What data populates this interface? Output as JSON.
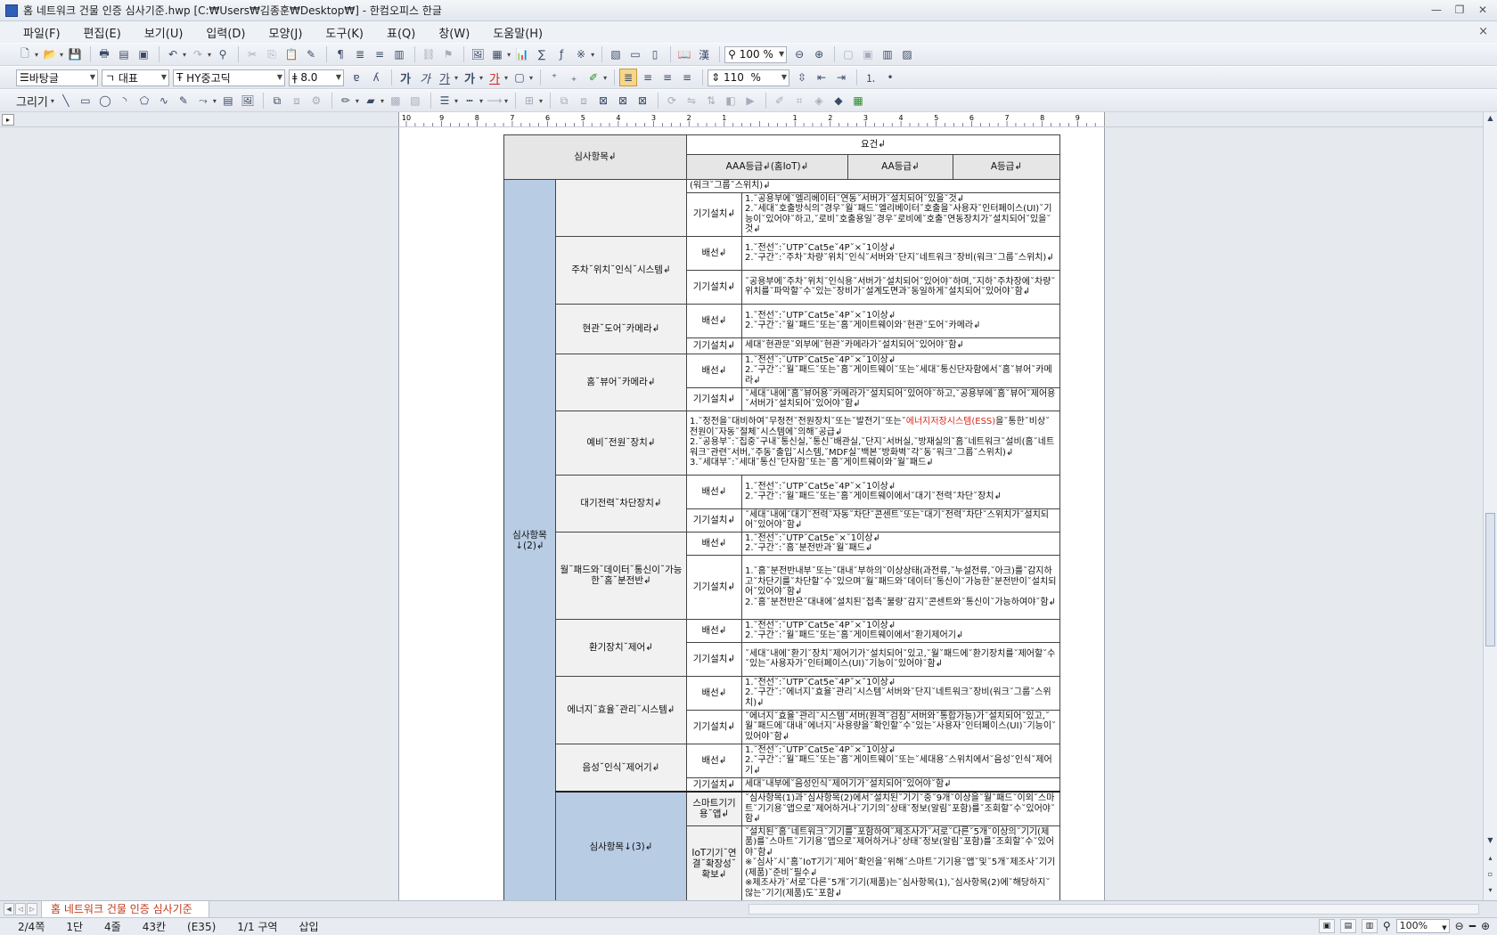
{
  "window": {
    "title": "홈 네트워크 건물 인증 심사기준.hwp [C:₩Users₩김종훈₩Desktop₩] - 한컴오피스 한글",
    "controls": [
      "—",
      "❐",
      "✕"
    ]
  },
  "menu": {
    "items": [
      "파일(F)",
      "편집(E)",
      "보기(U)",
      "입력(D)",
      "모양(J)",
      "도구(K)",
      "표(Q)",
      "창(W)",
      "도움말(H)"
    ],
    "close_doc": "×"
  },
  "toolbar1": {
    "zoom_value": "100 %"
  },
  "toolbar2": {
    "style": "바탕글",
    "lang_font": "대표",
    "font": "HY중고딕",
    "font_size": "8.0",
    "line_spacing": "110",
    "line_unit": "%",
    "glyph_bold": "가",
    "glyph_italic": "가",
    "glyph_underline": "가",
    "glyph_strike": "가",
    "glyph_color": "가"
  },
  "toolbar3": {
    "draw_label": "그리기"
  },
  "ruler": {
    "labels": [
      "10",
      "9",
      "8",
      "7",
      "6",
      "5",
      "4",
      "3",
      "2",
      "1",
      "",
      "1",
      "2",
      "3",
      "4",
      "5",
      "6",
      "7",
      "8",
      "9",
      "10"
    ]
  },
  "table": {
    "header": {
      "item": "심사항목↲",
      "requirements": "요건↲",
      "grade_aaa": "AAA등급↲(홈IoT)↲",
      "grade_aa": "AA등급↲",
      "grade_a": "A등급↲"
    },
    "groups": {
      "g2": "심사항목↓(2)↲",
      "g3": "심사항목↓(3)↲"
    },
    "rows": {
      "r0": {
        "req": "(워크˘그룹˘스위치)↲"
      },
      "r1": {
        "kind": "기기설치↲",
        "lines": [
          "1.˘공용부에˘엘리베이터˘연동˘서버가˘설치되어˘있을˘것↲",
          "2.˘세대˘호출방식의˘경우˘월˘패드˘엘리베이터˘호출을˘사용자˘인터페이스(UI)˘기능이˘있어야˘하고,˘로비˘호출용일˘경우˘로비에˘호출˘연동장치가˘설치되어˘있을˘것↲"
        ]
      },
      "parking": {
        "name": "주차˘위치˘인식˘시스템↲",
        "wiring": {
          "kind": "배선↲",
          "lines": [
            "1.˘전선˘:˘UTP˘Cat5e˘4P˘×˘1이상↲",
            "2.˘구간˘:˘주차˘차량˘위치˘인식˘서버와˘단지˘네트워크˘장비(워크˘그룹˘스위치)↲"
          ]
        },
        "install": {
          "kind": "기기설치↲",
          "lines": [
            "˘공용부에˘주차˘위치˘인식용˘서버가˘설치되어˘있어야˘하며,˘지하˘주차장에˘차량˘위치를˘파악할˘수˘있는˘장비가˘설계도면과˘동일하게˘설치되어˘있어야˘함↲"
          ]
        }
      },
      "door_cam": {
        "name": "현관˘도어˘카메라↲",
        "wiring": {
          "kind": "배선↲",
          "lines": [
            "1.˘전선˘:˘UTP˘Cat5e˘4P˘×˘1이상↲",
            "2.˘구간˘:˘월˘패드˘또는˘홈˘게이트웨이와˘현관˘도어˘카메라↲"
          ]
        },
        "install": {
          "kind": "기기설치↲",
          "lines": [
            "세대˘현관문˘외부에˘현관˘카메라가˘설치되어˘있어야˘함↲"
          ]
        }
      },
      "home_cam": {
        "name": "홈˘뷰어˘카메라↲",
        "wiring": {
          "kind": "배선↲",
          "lines": [
            "1.˘전선˘:˘UTP˘Cat5e˘4P˘×˘1이상↲",
            "2.˘구간˘:˘월˘패드˘또는˘홈˘게이트웨이˘또는˘세대˘통신단자함에서˘홈˘뷰어˘카메라↲"
          ]
        },
        "install": {
          "kind": "기기설치↲",
          "lines": [
            "˘세대˘내에˘홈˘뷰어용˘카메라가˘설치되어˘있어야˘하고,˘공용부에˘홈˘뷰어˘제어용˘서버가˘설치되어˘있어야˘함↲"
          ]
        }
      },
      "backup": {
        "name": "예비˘전원˘장치↲",
        "line1a": "1.˘정전을˘대비하여˘무정전˘전원장치˘또는˘발전기˘또는˘",
        "line1red": "에너지저장시스템(ESS)",
        "line1b": "을˘통한˘비상˘전원이˘자동˘절체˘시스템에˘의해˘공급↲",
        "line2": "2.˘공용부˘:˘집중˘구내˘통신실,˘통신˘배관실,˘단지˘서버실,˘방재실의˘홈˘네트워크˘설비(홈˘네트워크˘관련˘서버,˘주동˘출입˘시스템,˘MDF실˘백본˘방화벽˘각˘동˘워크˘그룹˘스위치)↲",
        "line3": "3.˘세대부˘:˘세대˘통신˘단자함˘또는˘홈˘게이트웨이와˘월˘패드↲"
      },
      "standby": {
        "name": "대기전력˘차단장치↲",
        "wiring": {
          "kind": "배선↲",
          "lines": [
            "1.˘전선˘:˘UTP˘Cat5e˘4P˘×˘1이상↲",
            "2.˘구간˘:˘월˘패드˘또는˘홈˘게이트웨이에서˘대기˘전력˘차단˘장치↲"
          ]
        },
        "install": {
          "kind": "기기설치↲",
          "lines": [
            "˘세대˘내에˘대기˘전력˘자동˘차단˘콘센트˘또는˘대기˘전력˘차단˘스위치가˘설치되어˘있어야˘함↲"
          ]
        }
      },
      "panel": {
        "name": "월˘패드와˘데이터˘통신이˘가능한˘홈˘분전반↲",
        "wiring": {
          "kind": "배선↲",
          "lines": [
            "1.˘전선˘:˘UTP˘Cat5e˘×˘1이상↲",
            "2.˘구간˘:˘홈˘분전반과˘월˘패드↲"
          ]
        },
        "install": {
          "kind": "기기설치↲",
          "lines": [
            "1.˘홈˘분전반내부˘또는˘대내˘부하의˘이상상태(과전류,˘누설전류,˘아크)를˘감지하고˘차단기를˘차단할˘수˘있으며˘월˘패드와˘데이터˘통신이˘가능한˘분전반이˘설치되어˘있어야˘함↲",
            "2.˘홈˘분전반은˘대내에˘설치된˘접촉˘불량˘감지˘콘센트와˘통신이˘가능하여야˘함↲"
          ]
        }
      },
      "vent": {
        "name": "환기장치˘제어↲",
        "wiring": {
          "kind": "배선↲",
          "lines": [
            "1.˘전선˘:˘UTP˘Cat5e˘4P˘×˘1이상↲",
            "2.˘구간˘:˘월˘패드˘또는˘홈˘게이트웨이에서˘환기제어기↲"
          ]
        },
        "install": {
          "kind": "기기설치↲",
          "lines": [
            "˘세대˘내에˘환기˘장치˘제어기가˘설치되어˘있고,˘월˘패드에˘환기장치를˘제어할˘수˘있는˘사용자가˘인터페이스(UI)˘기능이˘있어야˘함↲"
          ]
        }
      },
      "energy": {
        "name": "에너지˘효율˘관리˘시스템↲",
        "wiring": {
          "kind": "배선↲",
          "lines": [
            "1.˘전선˘:˘UTP˘Cat5e˘4P˘×˘1이상↲",
            "2.˘구간˘:˘에너지˘효율˘관리˘시스템˘서버와˘단지˘네트워크˘장비(워크˘그룹˘스위치)↲"
          ]
        },
        "install": {
          "kind": "기기설치↲",
          "lines": [
            "˘에너지˘효율˘관리˘시스템˘서버(원격˘검침˘서버와˘통합가능)가˘설치되어˘있고,˘월˘패드에˘대내˘에너지˘사용량을˘확인할˘수˘있는˘사용자˘인터페이스(UI)˘기능이˘있어야˘함↲"
          ]
        }
      },
      "voice": {
        "name": "음성˘인식˘제어기↲",
        "wiring": {
          "kind": "배선↲",
          "lines": [
            "1.˘전선˘:˘UTP˘Cat5e˘4P˘×˘1이상↲",
            "2.˘구간˘:˘월˘패드˘또는˘홈˘게이트웨이˘또는˘세대용˘스위치에서˘음성˘인식˘제어기↲"
          ]
        },
        "install": {
          "kind": "기기설치↲",
          "lines": [
            "세대˘내부에˘음성인식˘제어기가˘설치되어˘있어야˘함↲"
          ]
        }
      },
      "smartapp": {
        "name": "스마트기기용˘앱↲",
        "lines": [
          "˘심사항목(1)과˘심사항목(2)에서˘설치된˘기기˘중˘9개˘이상을˘월˘패드˘이외˘스마트˘기기용˘앱으로˘제어하거나˘기기의˘상태˘정보(알림˘포함)를˘조회할˘수˘있어야˘함↲"
        ]
      },
      "iot": {
        "name": "IoT기기˘연결˘확장성˘확보↲",
        "lines": [
          "˘설치된˘홈˘네트워크˘기기를˘포함하여˘제조사가˘서로˘다른˘5개˘이상의˘기기(제품)를˘스마트˘기기용˘앱으로˘제어하거나˘상태˘정보(알림˘포함)를˘조회할˘수˘있어야˘함↲",
          "※˘심사˘시˘홈˘IoT기기˘제어˘확인을˘위해˘스마트˘기기용˘앱˘및˘5개˘제조사˘기기(제품)˘준비˘필수↲",
          "※제조사가˘서로˘다른˘5개˘기기(제품)는˘심사항목(1),˘심사항목(2)에˘해당하지˘않는˘기기(제품)도˘포함↲"
        ]
      }
    }
  },
  "tabbar": {
    "doc_tab": "홈 네트워크 건물 인증 심사기준"
  },
  "status": {
    "page": "2/4쪽",
    "column": "1단",
    "line": "4줄",
    "col": "43칸",
    "cell": "(E35)",
    "section": "1/1 구역",
    "mode": "삽입",
    "zoom": "100%"
  }
}
